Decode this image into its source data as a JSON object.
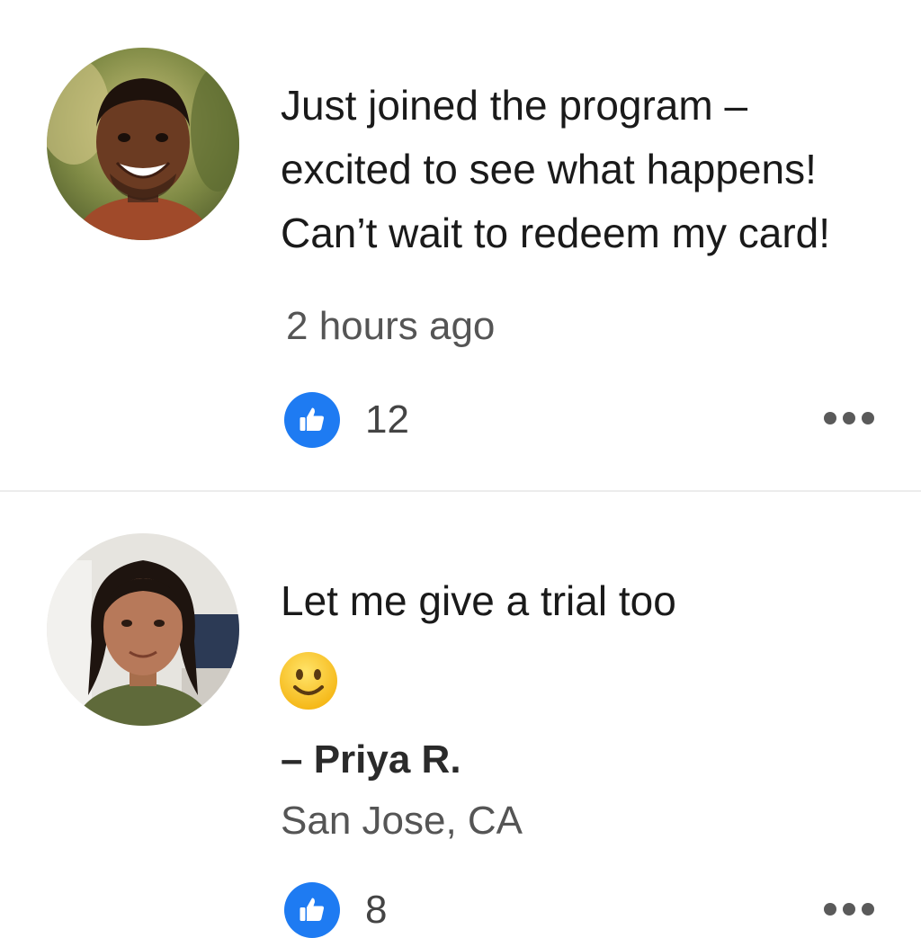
{
  "posts": [
    {
      "lines": [
        "Just joined the program –",
        "excited to see what happens!",
        "Can’t wait to redeem my card!"
      ],
      "timestamp": "2 hours ago",
      "likes": "12",
      "like_icon": "thumbs-up-icon",
      "more_icon": "more-options-icon"
    },
    {
      "lines": [
        "Let me give a trial too"
      ],
      "emoji": "slightly-smiling-face-icon",
      "author": "– Priya R.",
      "location": "San Jose, CA",
      "likes": "8",
      "like_icon": "thumbs-up-icon",
      "more_icon": "more-options-icon"
    }
  ],
  "colors": {
    "like_blue": "#1e7bf2",
    "divider": "#ececec",
    "secondary_text": "#555555"
  }
}
